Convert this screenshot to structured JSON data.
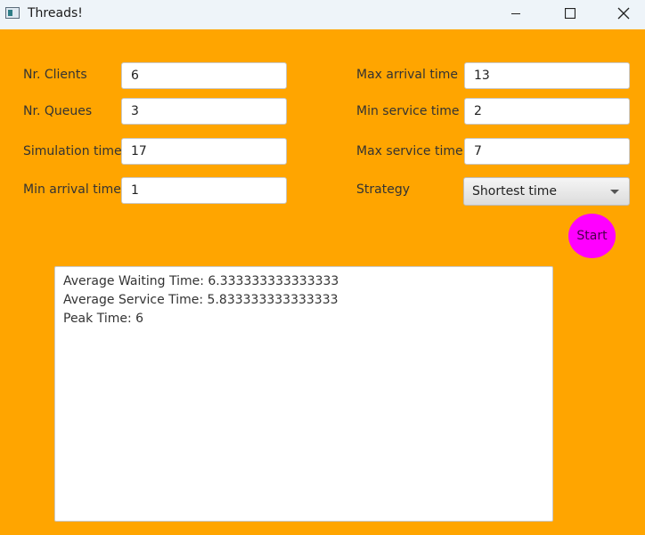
{
  "window": {
    "title": "Threads!",
    "icons": {
      "app": "app-window-icon",
      "minimize": "minimize-icon",
      "maximize": "maximize-icon",
      "close": "close-icon"
    }
  },
  "colors": {
    "background": "#ffa500",
    "start_button": "#ff00ff",
    "field_background": "#ffffff"
  },
  "form": {
    "nr_clients": {
      "label": "Nr. Clients",
      "value": "6"
    },
    "nr_queues": {
      "label": "Nr. Queues",
      "value": "3"
    },
    "simulation_time": {
      "label": "Simulation time",
      "value": "17"
    },
    "min_arrival_time": {
      "label": "Min arrival time",
      "value": "1"
    },
    "max_arrival_time": {
      "label": "Max arrival time",
      "value": "13"
    },
    "min_service_time": {
      "label": "Min service time",
      "value": "2"
    },
    "max_service_time": {
      "label": "Max service time",
      "value": "7"
    },
    "strategy": {
      "label": "Strategy",
      "value": "Shortest time"
    }
  },
  "start_label": "Start",
  "output": {
    "lines": [
      "Average Waiting Time: 6.333333333333333",
      "Average Service Time: 5.833333333333333",
      "Peak Time: 6"
    ]
  }
}
